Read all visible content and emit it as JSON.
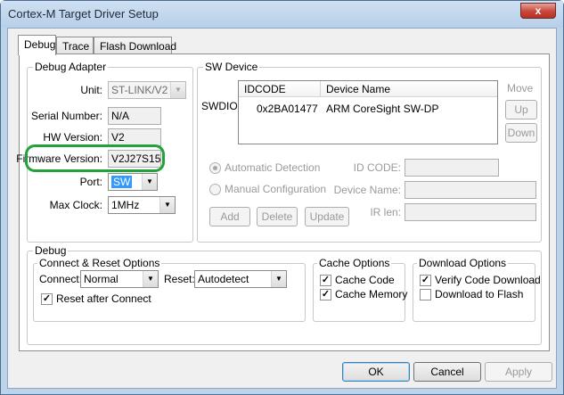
{
  "window": {
    "title": "Cortex-M Target Driver Setup",
    "close": "x"
  },
  "tabs": [
    "Debug",
    "Trace",
    "Flash Download"
  ],
  "debug_adapter": {
    "title": "Debug Adapter",
    "unit_label": "Unit:",
    "unit_value": "ST-LINK/V2",
    "serial_label": "Serial Number:",
    "serial_value": "N/A",
    "hw_label": "HW Version:",
    "hw_value": "V2",
    "fw_label": "Firmware Version:",
    "fw_value": "V2J27S15",
    "port_label": "Port:",
    "port_value": "SW",
    "clock_label": "Max Clock:",
    "clock_value": "1MHz"
  },
  "sw_device": {
    "title": "SW Device",
    "swdio_label": "SWDIO",
    "col_idcode": "IDCODE",
    "col_device": "Device Name",
    "row_idcode": "0x2BA01477",
    "row_device": "ARM CoreSight SW-DP",
    "move_label": "Move",
    "up": "Up",
    "down": "Down",
    "auto_detect": "Automatic Detection",
    "manual_config": "Manual Configuration",
    "id_code_label": "ID CODE:",
    "device_name_label": "Device Name:",
    "ir_len_label": "IR len:",
    "add": "Add",
    "delete": "Delete",
    "update": "Update"
  },
  "debug": {
    "title": "Debug",
    "connect_reset": {
      "title": "Connect & Reset Options",
      "connect_label": "Connect:",
      "connect_value": "Normal",
      "reset_label": "Reset:",
      "reset_value": "Autodetect",
      "reset_after_connect": "Reset after Connect"
    },
    "cache": {
      "title": "Cache Options",
      "code": "Cache Code",
      "memory": "Cache Memory"
    },
    "download": {
      "title": "Download Options",
      "verify": "Verify Code Download",
      "flash": "Download to Flash"
    }
  },
  "footer": {
    "ok": "OK",
    "cancel": "Cancel",
    "apply": "Apply"
  }
}
